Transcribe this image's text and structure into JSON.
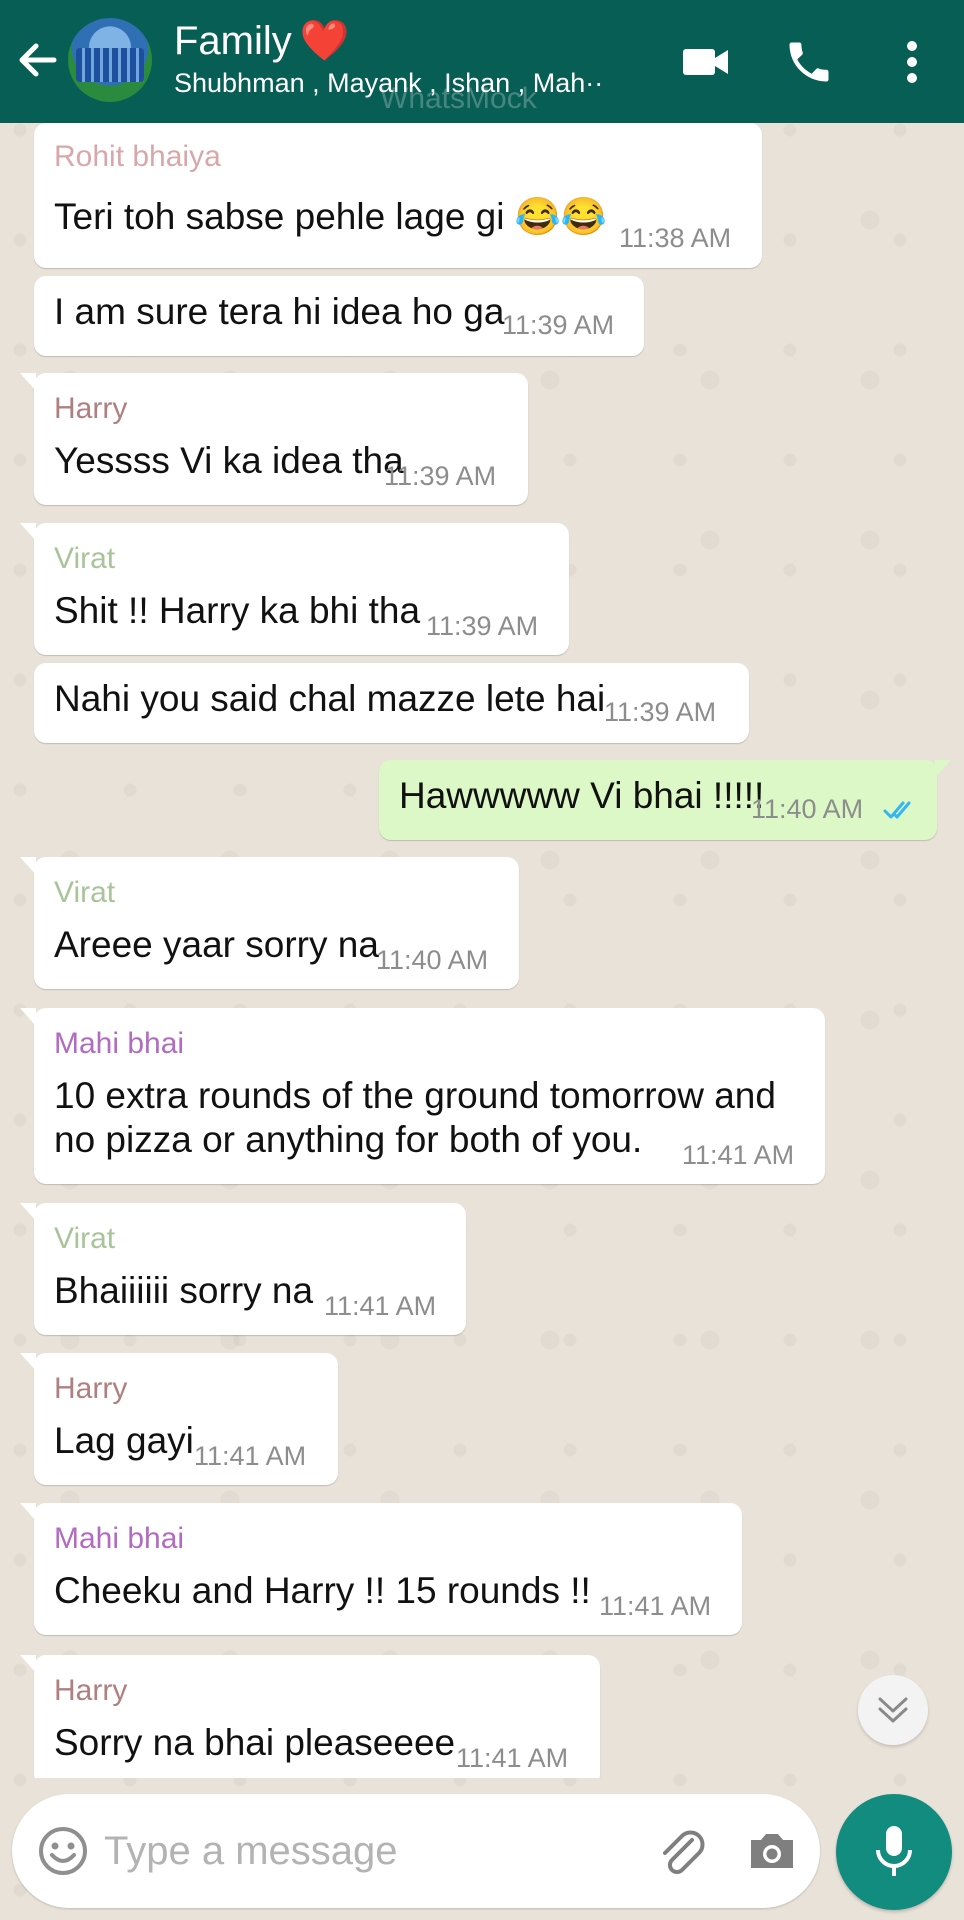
{
  "header": {
    "title": "Family",
    "title_emoji": "❤️",
    "members": "Shubhman , Mayank , Ishan , Mah··",
    "watermark": "WhatsMock",
    "accent_color": "#075e54"
  },
  "messages": [
    {
      "sender": "Rohit bhaiya",
      "sender_color": "#d9a7a9",
      "text": "Teri toh sabse pehle lage gi 😂😂",
      "time": "11:38 AM"
    },
    {
      "sender": "",
      "text": "I am sure tera hi idea ho ga",
      "time": "11:39 AM"
    },
    {
      "sender": "Harry",
      "sender_color": "#b07f7f",
      "text": "Yessss Vi ka idea tha",
      "time": "11:39 AM"
    },
    {
      "sender": "Virat",
      "sender_color": "#a9c49a",
      "text": "Shit !! Harry ka bhi tha",
      "time": "11:39 AM"
    },
    {
      "sender": "",
      "text": "Nahi you said chal mazze lete hai",
      "time": "11:39 AM"
    },
    {
      "sender": "",
      "text": "Hawwwww Vi bhai !!!!!",
      "time": "11:40 AM",
      "outgoing": true,
      "status": "read"
    },
    {
      "sender": "Virat",
      "sender_color": "#a9c49a",
      "text": "Areee yaar sorry na",
      "time": "11:40 AM"
    },
    {
      "sender": "Mahi bhai",
      "sender_color": "#b36bc2",
      "text_lines": [
        "10 extra rounds of the ground tomorrow and",
        "no pizza or anything for both of you."
      ],
      "time": "11:41 AM"
    },
    {
      "sender": "Virat",
      "sender_color": "#a9c49a",
      "text": "Bhaiiiiii sorry na",
      "time": "11:41 AM"
    },
    {
      "sender": "Harry",
      "sender_color": "#b07f7f",
      "text": "Lag gayi",
      "time": "11:41 AM"
    },
    {
      "sender": "Mahi bhai",
      "sender_color": "#b36bc2",
      "text": "Cheeku and Harry !! 15 rounds !!",
      "time": "11:41 AM"
    },
    {
      "sender": "Harry",
      "sender_color": "#b07f7f",
      "text": "Sorry na bhai pleaseeee",
      "time": "11:41 AM"
    }
  ],
  "input": {
    "placeholder": "Type a message"
  },
  "icons": {
    "back": "arrow-left-icon",
    "video": "video-camera-icon",
    "call": "phone-icon",
    "menu": "more-vertical-icon",
    "emoji": "emoji-icon",
    "attach": "paperclip-icon",
    "camera": "camera-icon",
    "mic": "microphone-icon",
    "scroll": "chevrons-down-icon"
  }
}
